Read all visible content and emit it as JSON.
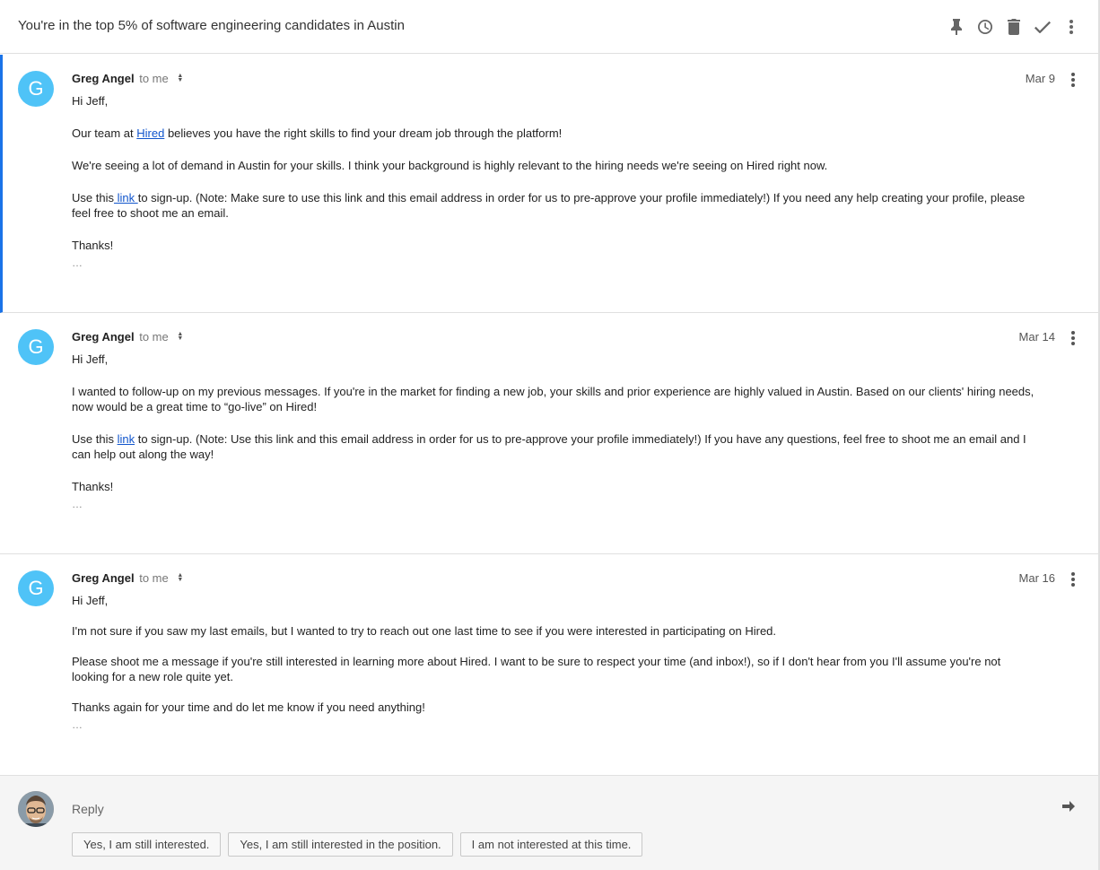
{
  "thread": {
    "subject": "You're in the top 5% of software engineering candidates in Austin",
    "toolbar_icons": [
      "pin-icon",
      "snooze-icon",
      "trash-icon",
      "done-icon",
      "more-icon"
    ]
  },
  "messages": [
    {
      "avatar_letter": "G",
      "sender": "Greg Angel",
      "recipient": "to me",
      "date": "Mar 9",
      "greeting": "Hi Jeff,",
      "p1_pre": "Our team at ",
      "p1_link": "Hired",
      "p1_post": " believes you have the right skills to find your dream job through the platform!",
      "p2": "We're seeing a lot of demand in Austin for your skills. I think your background is highly relevant to the hiring needs we're seeing on Hired right now.",
      "p3_pre": "Use this",
      "p3_link": " link ",
      "p3_post": "to sign-up. (Note: Make sure to use this link and this email address in order for us to pre-approve your profile immediately!) If you need any help creating your profile, please feel free to shoot me an email.",
      "closing": "Thanks!",
      "ellipsis": "…"
    },
    {
      "avatar_letter": "G",
      "sender": "Greg Angel",
      "recipient": "to me",
      "date": "Mar 14",
      "greeting": "Hi Jeff,",
      "p1": "I wanted to follow-up on my previous messages. If you're in the market for finding a new job, your skills and prior experience are highly valued in Austin. Based on our clients' hiring needs, now would be a great time to “go-live” on Hired!",
      "p2_pre": "Use this ",
      "p2_link": "link",
      "p2_post": " to sign-up. (Note: Use this link and this email address in order for us to pre-approve your profile immediately!) If you have any questions, feel free to shoot me an email and I can help out along the way!",
      "closing": "Thanks!",
      "ellipsis": "…"
    },
    {
      "avatar_letter": "G",
      "sender": "Greg Angel",
      "recipient": "to me",
      "date": "Mar 16",
      "greeting": "Hi Jeff,",
      "p1": "I'm not sure if you saw my last emails, but I wanted to try to reach out one last time to see if you were interested in participating on Hired.",
      "p2": "Please shoot me a message if you're still interested in learning more about Hired. I want to be sure to respect your time (and inbox!), so if I don't hear from you I'll assume you're not looking for a new role quite yet.",
      "closing": "Thanks again for your time and do let me know if you need anything!",
      "ellipsis": "…"
    }
  ],
  "reply": {
    "label": "Reply",
    "forward_icon": "forward-arrow-icon",
    "smart_replies": [
      "Yes, I am still interested.",
      "Yes, I am still interested in the position.",
      "I am not interested at this time."
    ]
  },
  "colors": {
    "avatar": "#4fc3f7",
    "link": "#1155cc",
    "active_bar": "#1a73e8"
  }
}
